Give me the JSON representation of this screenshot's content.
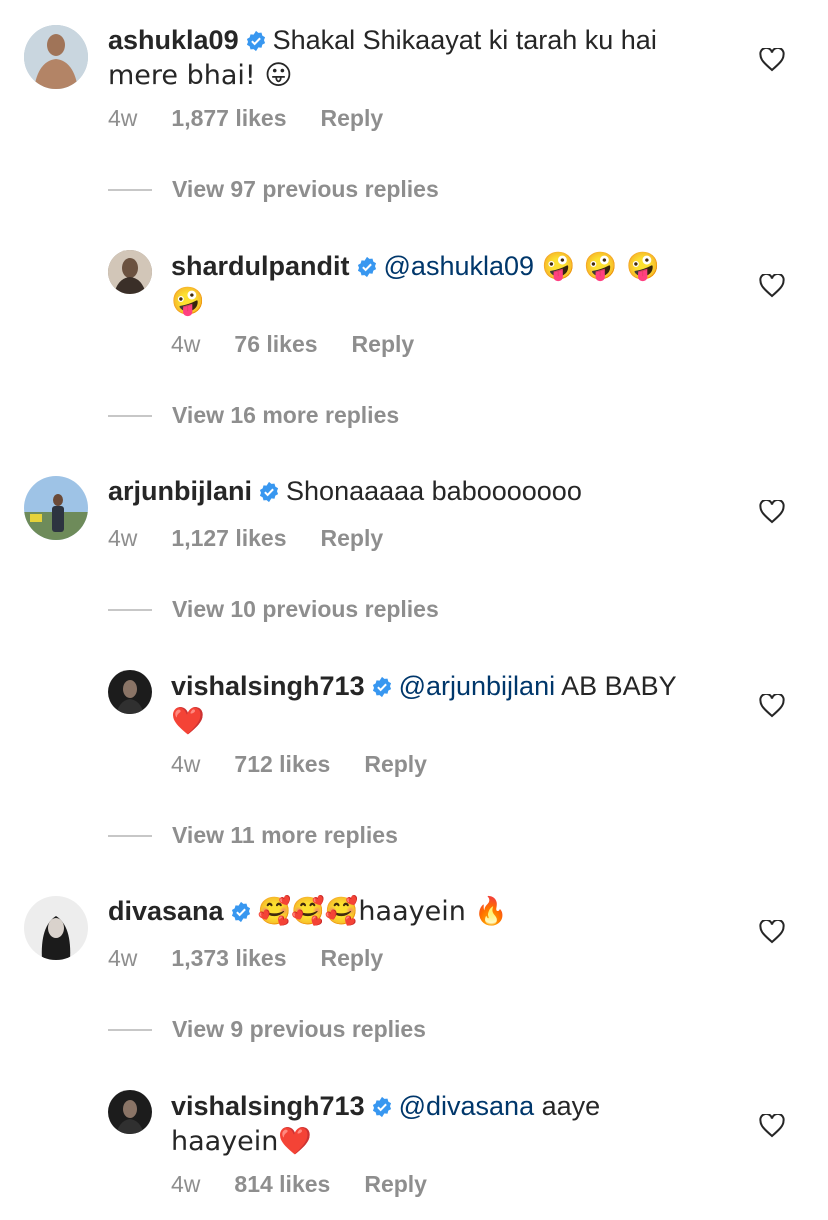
{
  "comments": [
    {
      "username": "ashukla09",
      "text_line1": "Shakal Shikaayat ki tarah ku hai",
      "text_line2": "mere bhai! 😛",
      "time": "4w",
      "likes": "1,877 likes",
      "reply": "Reply"
    },
    {
      "view_label": "View 97 previous replies"
    },
    {
      "username": "shardulpandit",
      "mention": "@ashukla09",
      "emojis_line1": "🤪 🤪 🤪",
      "emojis_line2": "🤪",
      "time": "4w",
      "likes": "76 likes",
      "reply": "Reply"
    },
    {
      "view_label": "View 16 more replies"
    },
    {
      "username": "arjunbijlani",
      "text_line1": "Shonaaaaa babooooooo",
      "time": "4w",
      "likes": "1,127 likes",
      "reply": "Reply"
    },
    {
      "view_label": "View 10 previous replies"
    },
    {
      "username": "vishalsingh713",
      "mention": "@arjunbijlani",
      "text_line1": "AB BABY",
      "text_line2": "❤️",
      "time": "4w",
      "likes": "712 likes",
      "reply": "Reply"
    },
    {
      "view_label": "View 11 more replies"
    },
    {
      "username": "divasana",
      "text_line1": "🥰🥰🥰haayein 🔥",
      "time": "4w",
      "likes": "1,373 likes",
      "reply": "Reply"
    },
    {
      "view_label": "View 9 previous replies"
    },
    {
      "username": "vishalsingh713",
      "mention": "@divasana",
      "text_line1": "aaye",
      "text_line2": "haayein❤️",
      "time": "4w",
      "likes": "814 likes",
      "reply": "Reply"
    }
  ],
  "icons": {
    "verified": "verified-badge-icon",
    "like": "heart-outline-icon"
  },
  "colors": {
    "text": "#262626",
    "secondary": "#8e8e8e",
    "mention": "#00376b",
    "verified": "#3897f0"
  }
}
